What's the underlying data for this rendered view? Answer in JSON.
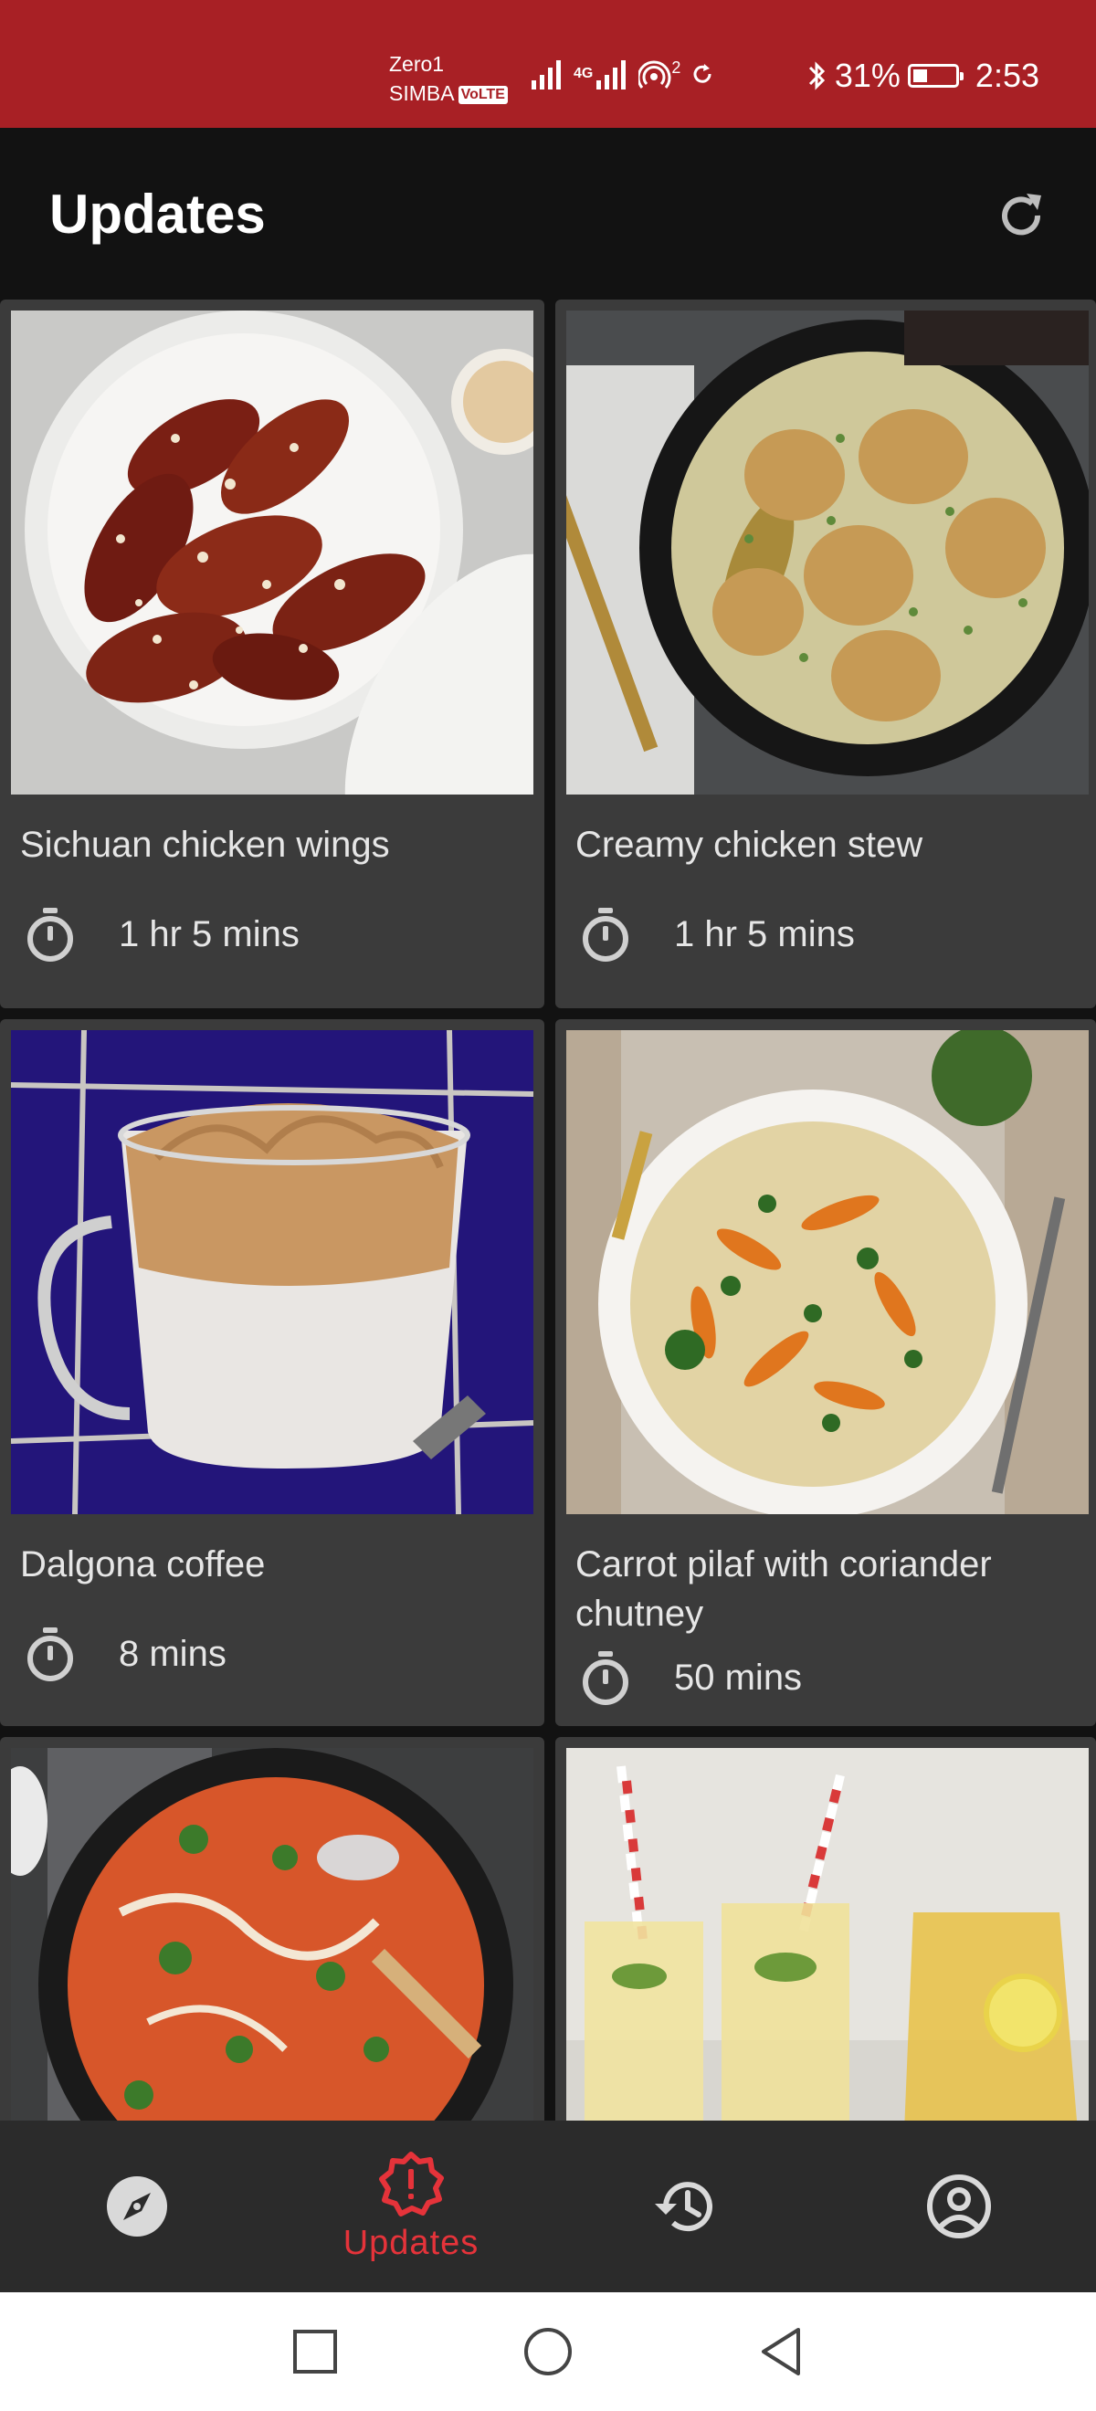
{
  "status_bar": {
    "carrier_line1": "Zero1",
    "carrier_line2": "SIMBA",
    "volte_badge": "VoLTE",
    "network_label": "4G",
    "hotspot_sub": "2",
    "battery_percent": "31%",
    "battery_level": 0.31,
    "time": "2:53"
  },
  "app_bar": {
    "title": "Updates",
    "refresh_icon": "refresh-icon"
  },
  "recipes": [
    {
      "title": "Sichuan chicken wings",
      "time": "1 hr 5 mins"
    },
    {
      "title": "Creamy chicken stew",
      "time": "1 hr 5 mins"
    },
    {
      "title": "Dalgona coffee",
      "time": "8 mins"
    },
    {
      "title": "Carrot pilaf with coriander chutney",
      "time": "50 mins"
    }
  ],
  "bottom_nav": {
    "items": [
      {
        "icon": "compass-icon",
        "label": ""
      },
      {
        "icon": "alert-badge-icon",
        "label": "Updates",
        "active": true
      },
      {
        "icon": "history-icon",
        "label": ""
      },
      {
        "icon": "account-icon",
        "label": ""
      }
    ],
    "active_color": "#e5333a",
    "inactive_color": "#d9d9d9"
  },
  "system_nav": {
    "icons": [
      "recents-icon",
      "home-icon",
      "back-icon"
    ]
  },
  "colors": {
    "status_bar": "#a82025",
    "background": "#121212",
    "card": "#3b3b3b",
    "nav": "#2b2b2b"
  }
}
